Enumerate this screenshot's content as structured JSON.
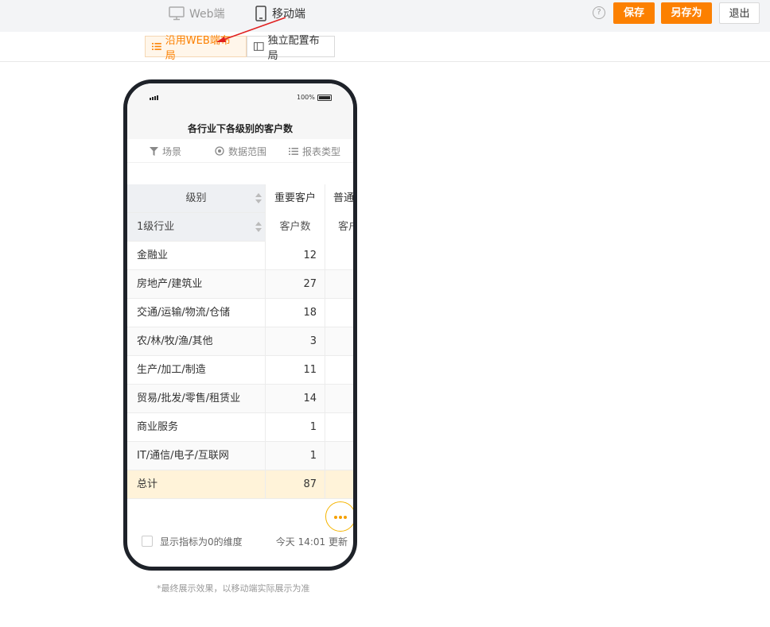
{
  "topbar": {
    "web_tab": "Web端",
    "mobile_tab": "移动端",
    "help": "?",
    "save": "保存",
    "save_as": "另存为",
    "exit": "退出"
  },
  "layout": {
    "inherit_web": "沿用WEB端布局",
    "independent": "独立配置布局"
  },
  "phone": {
    "status_percent": "100%",
    "title": "各行业下各级别的客户数",
    "tools": [
      "场景",
      "数据范围",
      "报表类型"
    ],
    "table": {
      "header1": [
        "级别",
        "重要客户",
        "普通"
      ],
      "header2": [
        "1级行业",
        "客户数",
        "客户"
      ],
      "rows": [
        {
          "name": "金融业",
          "value": "12"
        },
        {
          "name": "房地产/建筑业",
          "value": "27"
        },
        {
          "name": "交通/运输/物流/仓储",
          "value": "18"
        },
        {
          "name": "农/林/牧/渔/其他",
          "value": "3"
        },
        {
          "name": "生产/加工/制造",
          "value": "11"
        },
        {
          "name": "贸易/批发/零售/租赁业",
          "value": "14"
        },
        {
          "name": "商业服务",
          "value": "1"
        },
        {
          "name": "IT/通信/电子/互联网",
          "value": "1"
        }
      ],
      "total": {
        "name": "总计",
        "value": "87"
      }
    },
    "footer": {
      "checkbox_label": "显示指标为0的维度",
      "updated": "今天 14:01 更新"
    }
  },
  "note": "*最终展示效果，以移动端实际展示为准",
  "colors": {
    "accent": "#fc8000",
    "arrow": "#e02020",
    "total_bg": "#fff3d9"
  }
}
